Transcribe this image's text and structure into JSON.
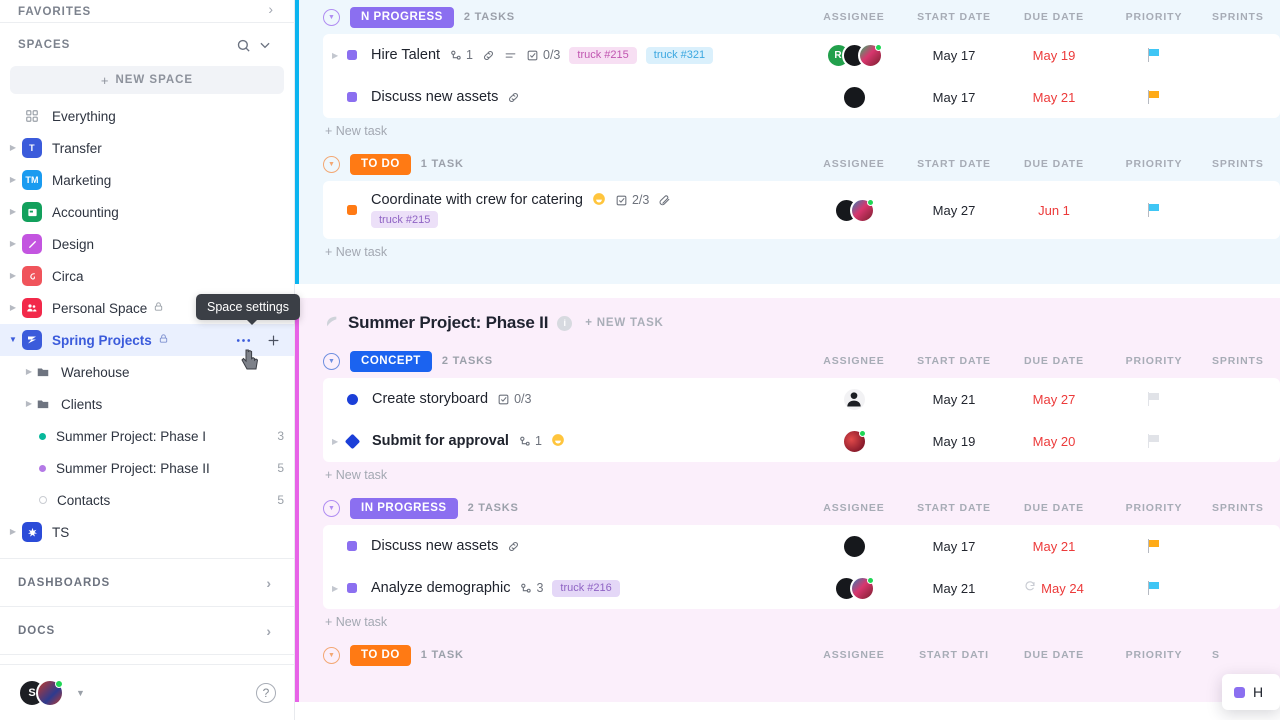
{
  "sidebar": {
    "favorites_label": "FAVORITES",
    "spaces_label": "SPACES",
    "new_space_label": "NEW SPACE",
    "search_icon": "search-icon",
    "collapse_icon": "chevron-down-icon",
    "spaces": [
      {
        "label": "Everything",
        "glyph": "",
        "color": "transparent",
        "has_caret": false,
        "locked": false
      },
      {
        "label": "Transfer",
        "glyph": "T",
        "color": "#3b5bdb",
        "has_caret": true,
        "locked": false
      },
      {
        "label": "Marketing",
        "glyph": "TM",
        "color": "#1a9bf0",
        "has_caret": true,
        "locked": false
      },
      {
        "label": "Accounting",
        "glyph": "▤",
        "color": "#12a05c",
        "has_caret": true,
        "locked": false
      },
      {
        "label": "Design",
        "glyph": "✎",
        "color": "#c355e0",
        "has_caret": true,
        "locked": false
      },
      {
        "label": "Circa",
        "glyph": "৶",
        "color": "#f0545b",
        "has_caret": true,
        "locked": false
      },
      {
        "label": "Personal Space",
        "glyph": "👥",
        "color": "#f2294a",
        "has_caret": true,
        "locked": true
      },
      {
        "label": "Spring Projects",
        "glyph": "≥",
        "color": "#3b5bdb",
        "has_caret": true,
        "locked": true,
        "active": true
      }
    ],
    "spring_children": [
      {
        "label": "Warehouse",
        "type": "folder",
        "count": ""
      },
      {
        "label": "Clients",
        "type": "folder",
        "count": ""
      },
      {
        "label": "Summer Project: Phase I",
        "type": "list",
        "dot": "#07b89b",
        "count": "3"
      },
      {
        "label": "Summer Project: Phase II",
        "type": "list",
        "dot": "#b47ae6",
        "count": "5"
      },
      {
        "label": "Contacts",
        "type": "ring",
        "dot": "",
        "count": "5"
      }
    ],
    "ts_space": {
      "label": "TS",
      "glyph": "✳",
      "color": "#2b4bd8"
    },
    "dashboards_label": "DASHBOARDS",
    "docs_label": "DOCS",
    "footer": {
      "avatars": [
        {
          "initials": "S",
          "color": "#1d1f24",
          "presence": false
        },
        {
          "initials": "",
          "color": "#c0392b",
          "presence": true
        }
      ],
      "help_icon": "question-mark-icon"
    },
    "space_settings_tooltip": "Space settings",
    "space_more_icon": "more-options-icon",
    "space_add_icon": "plus-icon"
  },
  "columns": [
    "ASSIGNEE",
    "START DATE",
    "DUE DATE",
    "PRIORITY",
    "SPRINTS"
  ],
  "columns_partial": [
    "ASSIGNEE",
    "START DATI",
    "DUE DATE",
    "PRIORITY",
    "S"
  ],
  "new_task_label": "+ New task",
  "new_task_upper": "+ NEW TASK",
  "groups": [
    {
      "id": "phase-one",
      "accent": "#0ab4f0",
      "background": "#eef7fd",
      "show_project_header": false,
      "statuses": [
        {
          "name": "N PROGRESS",
          "full_name": "IN PROGRESS",
          "color": "#8b6ff0",
          "count_label": "2 TASKS",
          "tasks": [
            {
              "name": "Hire Talent",
              "marker": "square",
              "marker_color": "#8b6ff0",
              "expandable": true,
              "subtask_count": "1",
              "has_link": true,
              "has_description": true,
              "checklist": "0/3",
              "tags": [
                {
                  "label": "truck #215",
                  "bg": "#f7dff3",
                  "fg": "#c055b0"
                },
                {
                  "label": "truck #321",
                  "bg": "#daf0fc",
                  "fg": "#3ba7e0"
                }
              ],
              "assignees": [
                {
                  "initials": "R",
                  "color": "#22a04c",
                  "presence": false
                },
                {
                  "initials": "",
                  "color": "#16181c",
                  "presence": false
                },
                {
                  "initials": "",
                  "color": "#8e2b3f",
                  "presence": true
                }
              ],
              "start_date": "May 17",
              "due_date": "May 19",
              "priority": "#3fc6f5"
            },
            {
              "name": "Discuss new assets",
              "marker": "square",
              "marker_color": "#8b6ff0",
              "expandable": false,
              "has_link": true,
              "tags": [],
              "assignees": [
                {
                  "initials": "",
                  "color": "#16181c",
                  "presence": false
                }
              ],
              "start_date": "May 17",
              "due_date": "May 21",
              "priority": "#ffab17"
            }
          ]
        },
        {
          "name": "TO DO",
          "full_name": "TO DO",
          "color": "#ff7a14",
          "count_label": "1 TASK",
          "tasks": [
            {
              "name": "Coordinate with crew for catering",
              "marker": "square",
              "marker_color": "#ff7a14",
              "expandable": false,
              "emoji": "😊",
              "checklist": "2/3",
              "has_attachment": true,
              "tags": [
                {
                  "label": "truck #215",
                  "bg": "#ece0f8",
                  "fg": "#8f63c4"
                }
              ],
              "assignees": [
                {
                  "initials": "",
                  "color": "#16181c",
                  "presence": false
                },
                {
                  "initials": "",
                  "color": "#8e2b3f",
                  "presence": true
                }
              ],
              "start_date": "May 27",
              "due_date": "Jun 1",
              "priority": "#3fc6f5"
            }
          ]
        }
      ]
    },
    {
      "id": "phase-two",
      "accent": "#e763e7",
      "background": "#fbeffb",
      "show_project_header": true,
      "project_title": "Summer Project: Phase II",
      "project_badge": "i",
      "statuses": [
        {
          "name": "CONCEPT",
          "full_name": "CONCEPT",
          "color": "#1b63f0",
          "count_label": "2 TASKS",
          "tasks": [
            {
              "name": "Create storyboard",
              "marker": "dot",
              "marker_color": "#1b3fd8",
              "expandable": false,
              "checklist": "0/3",
              "tags": [],
              "assignees": [
                {
                  "initials": "",
                  "color": "#f3f3f5",
                  "presence": false,
                  "face": true
                }
              ],
              "start_date": "May 21",
              "due_date": "May 27",
              "priority": ""
            },
            {
              "name": "Submit for approval",
              "marker": "diamond",
              "marker_color": "#1b3fd8",
              "expandable": true,
              "subtask_count": "1",
              "emoji": "😊",
              "tags": [],
              "assignees": [
                {
                  "initials": "",
                  "color": "#a32230",
                  "presence": true
                }
              ],
              "start_date": "May 19",
              "due_date": "May 20",
              "priority": ""
            }
          ]
        },
        {
          "name": "IN PROGRESS",
          "full_name": "IN PROGRESS",
          "color": "#8b6ff0",
          "count_label": "2 TASKS",
          "tasks": [
            {
              "name": "Discuss new assets",
              "marker": "square",
              "marker_color": "#8b6ff0",
              "expandable": false,
              "has_link": true,
              "tags": [],
              "assignees": [
                {
                  "initials": "",
                  "color": "#16181c",
                  "presence": false
                }
              ],
              "start_date": "May 17",
              "due_date": "May 21",
              "priority": "#ffab17"
            },
            {
              "name": "Analyze demographic",
              "marker": "square",
              "marker_color": "#8b6ff0",
              "expandable": true,
              "subtask_count": "3",
              "tags": [
                {
                  "label": "truck #216",
                  "bg": "#e4d7f7",
                  "fg": "#8f63c4"
                }
              ],
              "assignees": [
                {
                  "initials": "",
                  "color": "#16181c",
                  "presence": false
                },
                {
                  "initials": "",
                  "color": "#8e2b3f",
                  "presence": true
                }
              ],
              "start_date": "May 21",
              "due_date": "May 24",
              "due_recurring": true,
              "priority": "#3fc6f5"
            }
          ]
        },
        {
          "name": "TO DO",
          "full_name": "TO DO",
          "color": "#ff7a14",
          "count_label": "1 TASK",
          "tasks": []
        }
      ]
    }
  ],
  "drag_preview": {
    "label": "H",
    "dot_color": "#8b6ff0"
  }
}
